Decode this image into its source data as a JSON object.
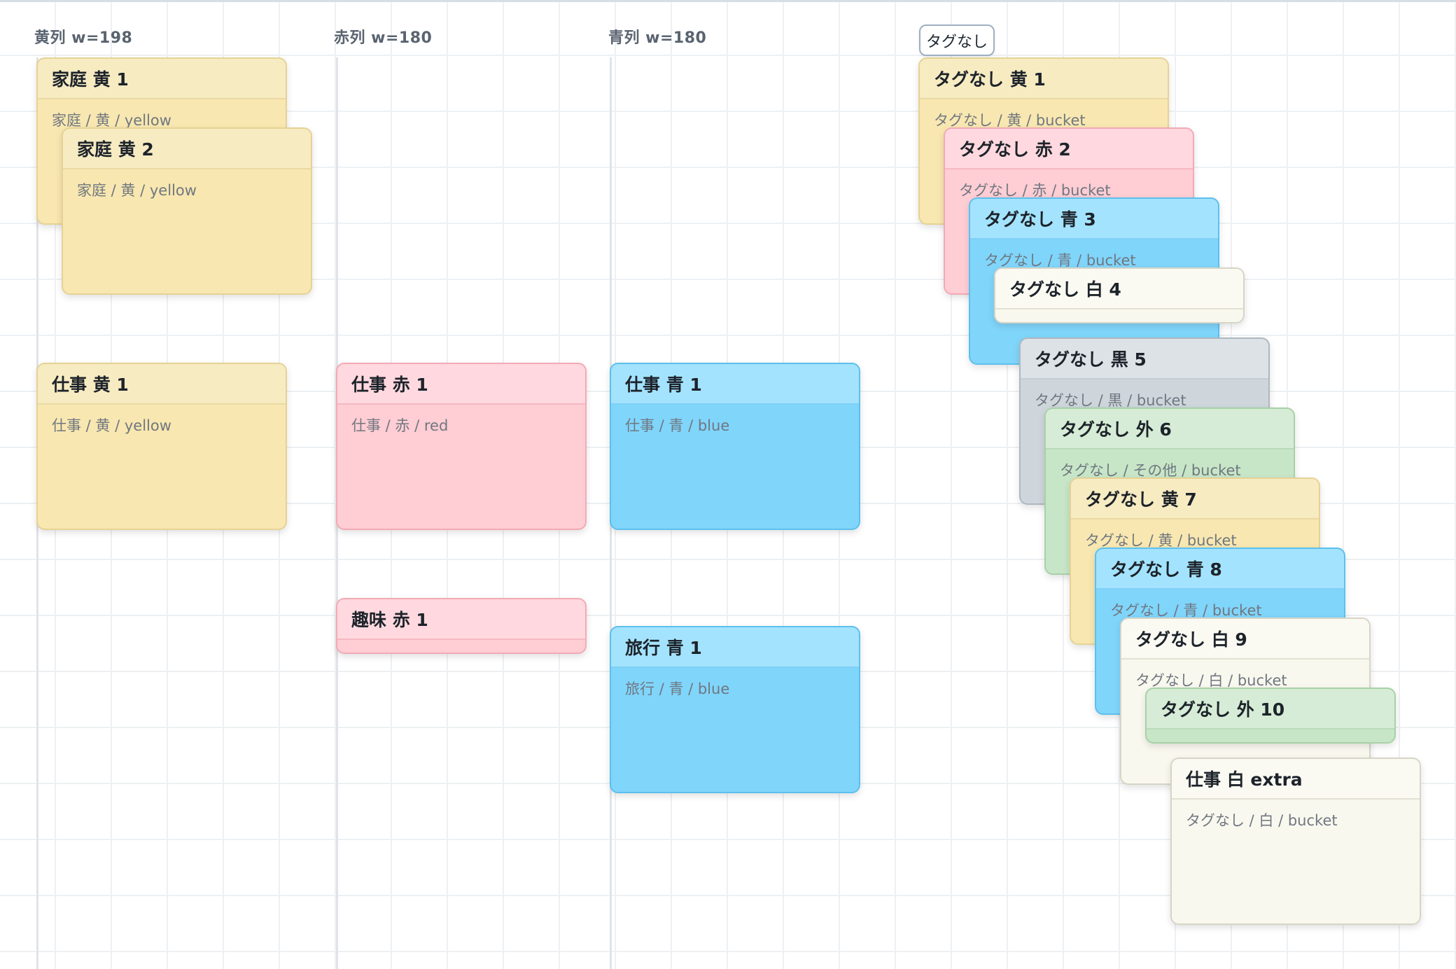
{
  "columns": {
    "yellow_label": "黄列 w=198",
    "red_label": "赤列 w=180",
    "blue_label": "青列 w=180",
    "untagged_chip": "タグなし"
  },
  "cards": {
    "katei_ki_1": {
      "title": "家庭 黄 1",
      "sub": "家庭 / 黄 / yellow"
    },
    "katei_ki_2": {
      "title": "家庭 黄 2",
      "sub": "家庭 / 黄 / yellow"
    },
    "shigoto_ki_1": {
      "title": "仕事 黄 1",
      "sub": "仕事 / 黄 / yellow"
    },
    "shigoto_aka_1": {
      "title": "仕事 赤 1",
      "sub": "仕事 / 赤 / red"
    },
    "shumi_aka_1": {
      "title": "趣味 赤 1",
      "sub": ""
    },
    "shigoto_ao_1": {
      "title": "仕事 青 1",
      "sub": "仕事 / 青 / blue"
    },
    "ryoko_ao_1": {
      "title": "旅行 青 1",
      "sub": "旅行 / 青 / blue"
    },
    "tagnashi_ki_1": {
      "title": "タグなし 黄 1",
      "sub": "タグなし / 黄 / bucket"
    },
    "tagnashi_aka_2": {
      "title": "タグなし 赤 2",
      "sub": "タグなし / 赤 / bucket"
    },
    "tagnashi_ao_3": {
      "title": "タグなし 青 3",
      "sub": "タグなし / 青 / bucket"
    },
    "tagnashi_shiro_4": {
      "title": "タグなし 白 4",
      "sub": ""
    },
    "tagnashi_kuro_5": {
      "title": "タグなし 黒 5",
      "sub": "タグなし / 黒 / bucket"
    },
    "tagnashi_gai_6": {
      "title": "タグなし 外 6",
      "sub": "タグなし / その他 / bucket"
    },
    "tagnashi_ki_7": {
      "title": "タグなし 黄 7",
      "sub": "タグなし / 黄 / bucket"
    },
    "tagnashi_ao_8": {
      "title": "タグなし 青 8",
      "sub": "タグなし / 青 / bucket"
    },
    "tagnashi_shiro_9": {
      "title": "タグなし 白 9",
      "sub": "タグなし / 白 / bucket"
    },
    "tagnashi_gai_10": {
      "title": "タグなし 外 10",
      "sub": ""
    },
    "shigoto_shiro_extra": {
      "title": "仕事 白 extra",
      "sub": "タグなし / 白 / bucket"
    }
  },
  "colors": {
    "yellow": "#f8e7b0",
    "red": "#ffcdd4",
    "blue": "#80d5fb",
    "white": "#f9f8ef",
    "black": "#ced6dc",
    "green": "#c7e6c7",
    "grid": "#eef1f4"
  }
}
